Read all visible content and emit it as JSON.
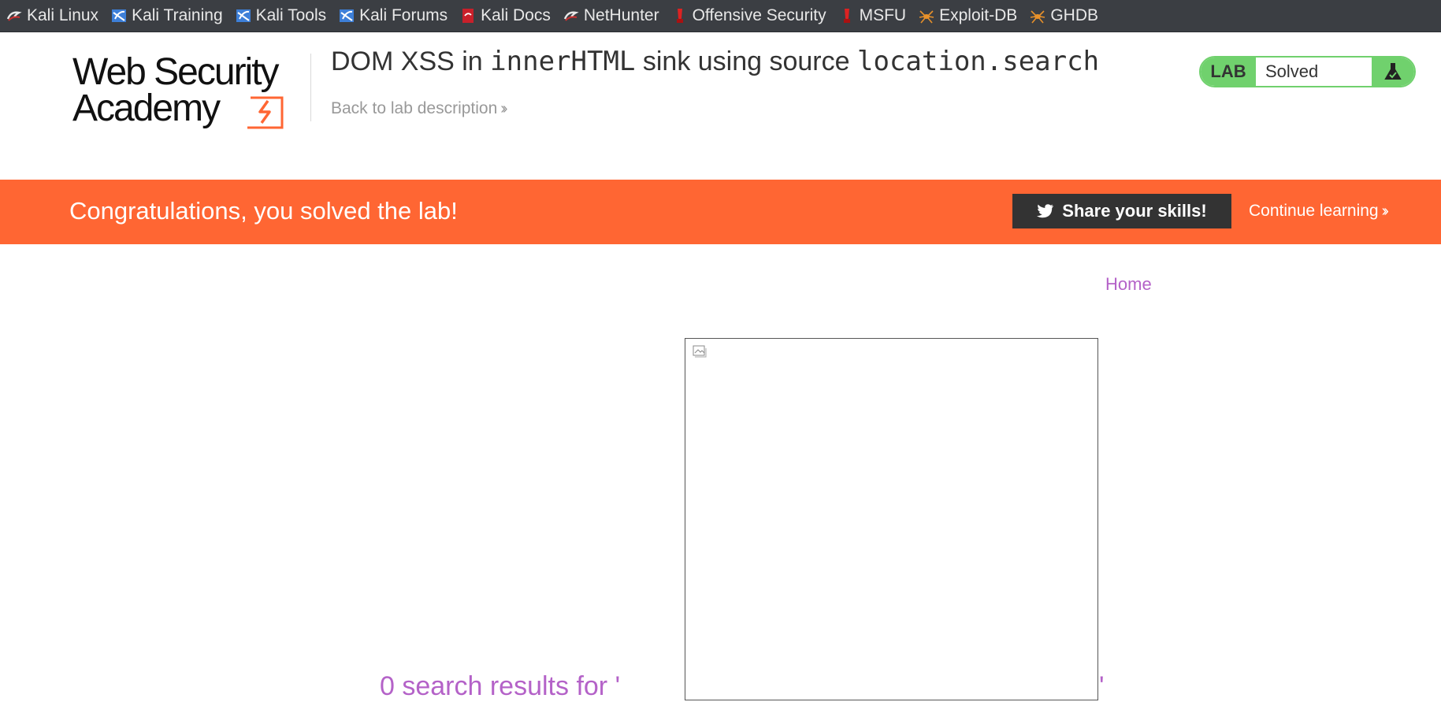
{
  "bookmarks": [
    {
      "label": "Kali Linux",
      "icon": "kali-dragon-icon"
    },
    {
      "label": "Kali Training",
      "icon": "kali-training-icon"
    },
    {
      "label": "Kali Tools",
      "icon": "kali-tools-icon"
    },
    {
      "label": "Kali Forums",
      "icon": "kali-forums-icon"
    },
    {
      "label": "Kali Docs",
      "icon": "kali-docs-icon"
    },
    {
      "label": "NetHunter",
      "icon": "nethunter-icon"
    },
    {
      "label": "Offensive Security",
      "icon": "offsec-icon"
    },
    {
      "label": "MSFU",
      "icon": "offsec-icon"
    },
    {
      "label": "Exploit-DB",
      "icon": "exploit-db-icon"
    },
    {
      "label": "GHDB",
      "icon": "exploit-db-icon"
    }
  ],
  "header": {
    "logo_line1": "Web Security",
    "logo_line2": "Academy",
    "title_part1": "DOM XSS in ",
    "title_code1": "innerHTML",
    "title_part2": " sink using source ",
    "title_code2": "location.search",
    "back_link": "Back to lab description",
    "status_tag": "LAB",
    "status_text": "Solved"
  },
  "banner": {
    "message": "Congratulations, you solved the lab!",
    "share_label": "Share your skills!",
    "continue_label": "Continue learning"
  },
  "nav": {
    "home": "Home"
  },
  "main": {
    "results_text": "0 search results for '",
    "results_close": "'"
  },
  "colors": {
    "accent": "#ff6633",
    "solved": "#70d16d",
    "link": "#b462c8",
    "bookmarks_bg": "#3b3e43"
  }
}
